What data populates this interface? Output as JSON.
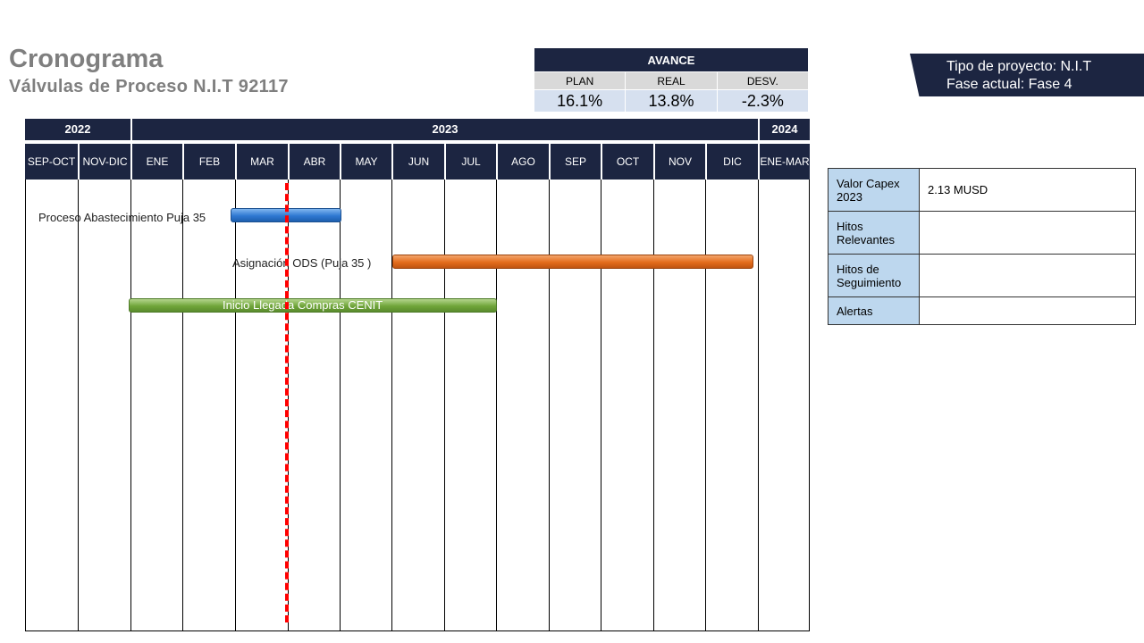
{
  "header": {
    "title": "Cronograma",
    "subtitle": "Válvulas de Proceso N.I.T 92117"
  },
  "avance": {
    "title": "AVANCE",
    "labels": [
      "PLAN",
      "REAL",
      "DESV."
    ],
    "values": [
      "16.1%",
      "13.8%",
      "-2.3%"
    ]
  },
  "project": {
    "type_line": "Tipo de proyecto: N.I.T",
    "phase_line": "Fase actual: Fase 4"
  },
  "gantt": {
    "years": [
      "2022",
      "2023",
      "2024"
    ],
    "periods": [
      "SEP-OCT",
      "NOV-DIC",
      "ENE",
      "FEB",
      "MAR",
      "ABR",
      "MAY",
      "JUN",
      "JUL",
      "AGO",
      "SEP",
      "OCT",
      "NOV",
      "DIC",
      "ENE-MAR"
    ],
    "tasks": [
      {
        "label": "Proceso Abastecimiento Puja 35",
        "start_period": "MAR",
        "end_period": "ABR",
        "color": "#2f78d2"
      },
      {
        "label": "Asignación ODS (Puja 35 )",
        "start_period": "JUN",
        "end_period": "DIC",
        "color": "#e46c1c"
      },
      {
        "label": "Inicio Llegada  Compras CENIT",
        "start_period": "ENE",
        "end_period": "JUL",
        "color": "#70a63a"
      }
    ],
    "today_period": "MAR",
    "today_color": "#ff0000"
  },
  "info": {
    "rows": [
      {
        "key": "Valor Capex 2023",
        "value": "2.13 MUSD"
      },
      {
        "key": "Hitos Relevantes",
        "value": ""
      },
      {
        "key": "Hitos de Seguimiento",
        "value": ""
      },
      {
        "key": "Alertas",
        "value": ""
      }
    ]
  },
  "colors": {
    "header_bg": "#1c2541",
    "info_key_bg": "#bdd7ee",
    "avance_value_bg": "#d6e0ef"
  }
}
